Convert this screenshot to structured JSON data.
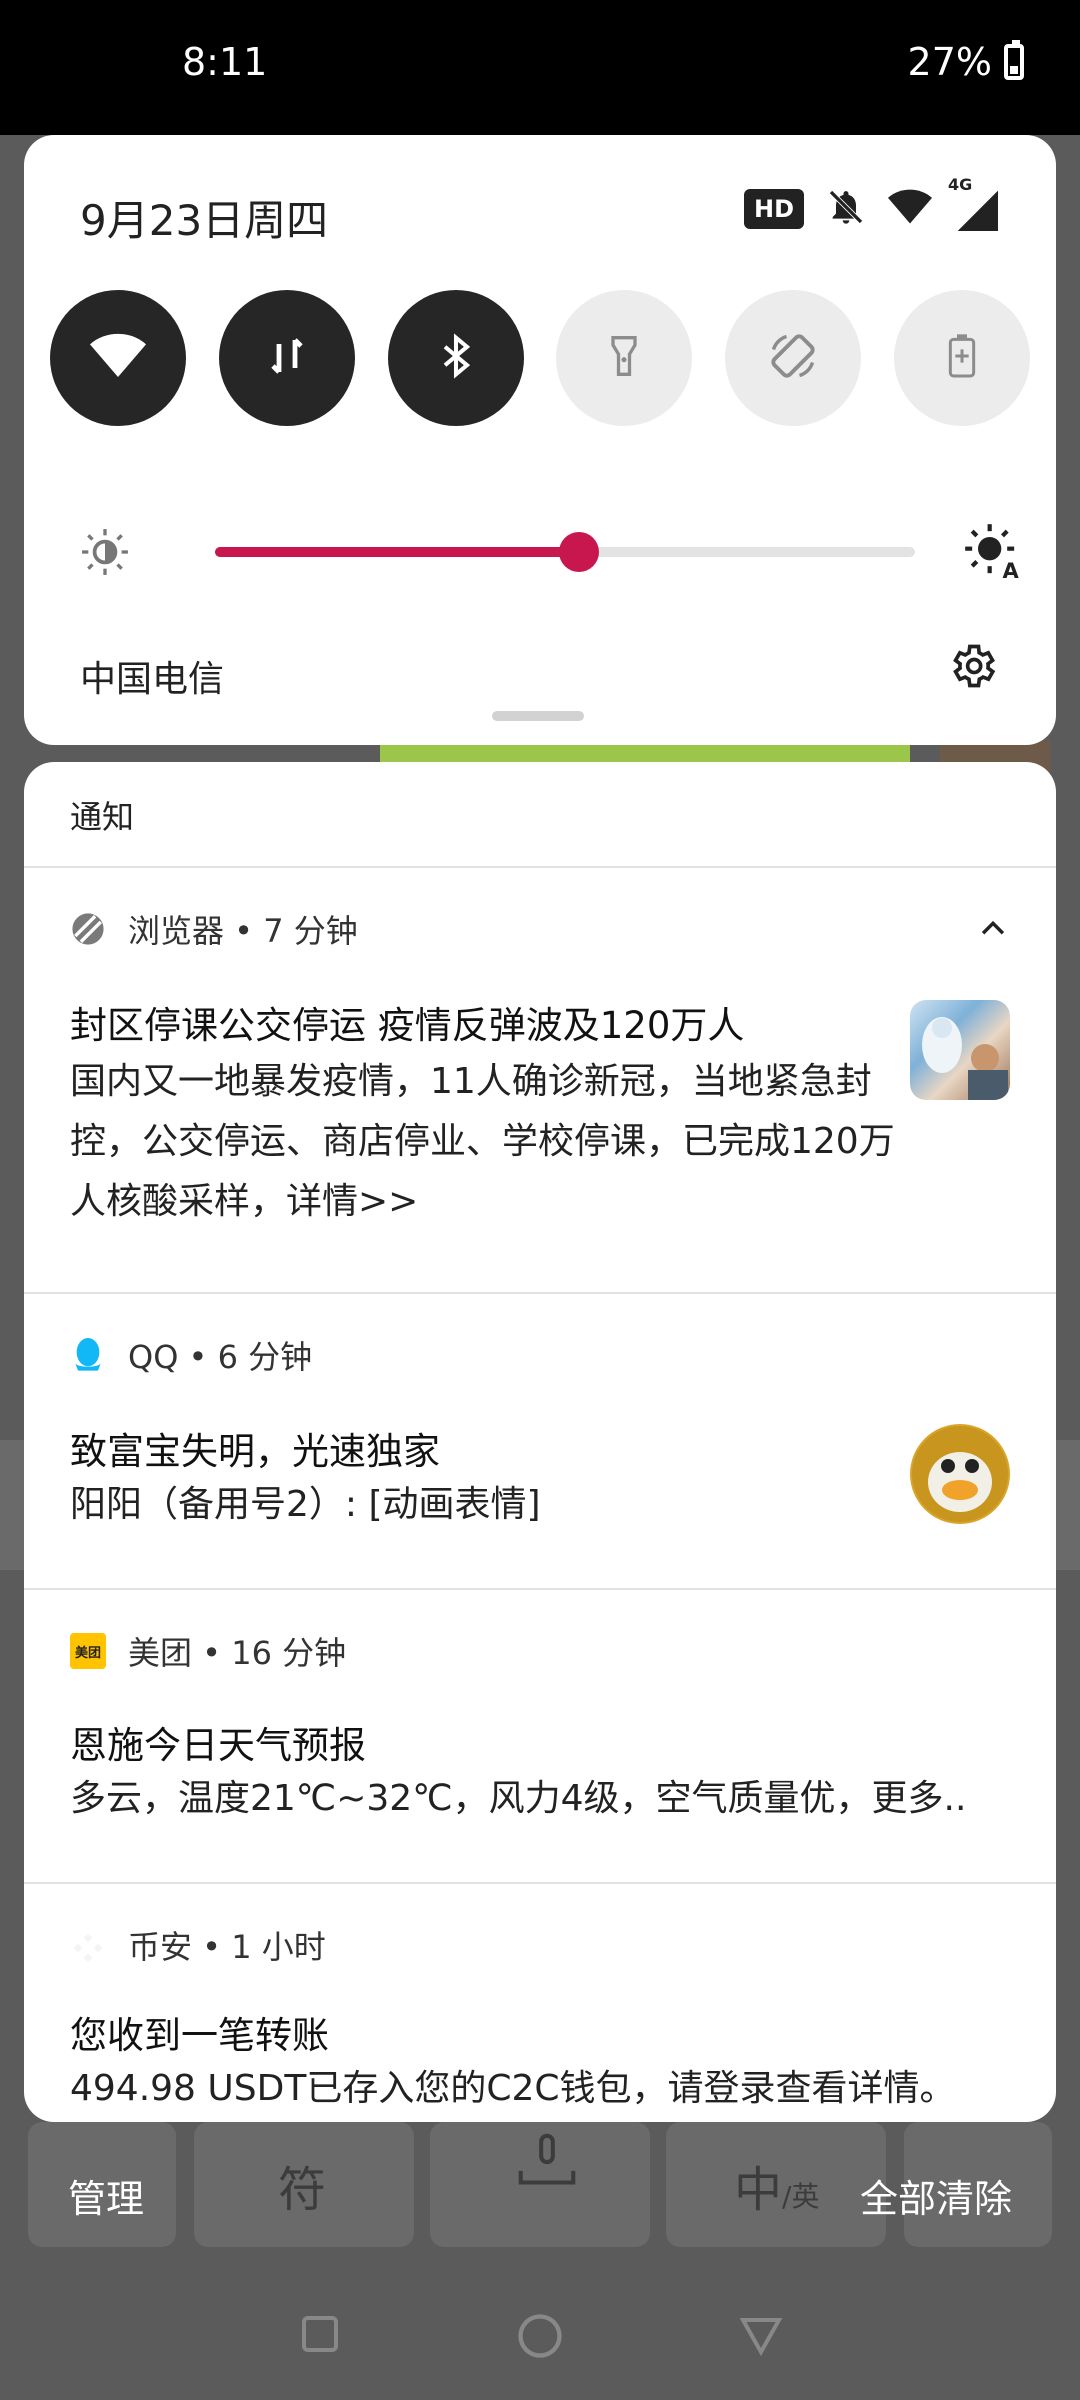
{
  "status_bar": {
    "time": "8:11",
    "battery": "27%"
  },
  "quick_settings": {
    "date": "9月23日周四",
    "status_icons": [
      "hd-badge",
      "bell-off-icon",
      "wifi-icon",
      "cellular-4g-icon"
    ],
    "hd_label": "HD",
    "network_label": "4G",
    "tiles": [
      {
        "name": "wifi-tile",
        "icon": "wifi-icon",
        "active": true
      },
      {
        "name": "mobile-data-tile",
        "icon": "data-transfer-icon",
        "active": true
      },
      {
        "name": "bluetooth-tile",
        "icon": "bluetooth-icon",
        "active": true
      },
      {
        "name": "flashlight-tile",
        "icon": "flashlight-icon",
        "active": false
      },
      {
        "name": "auto-rotate-tile",
        "icon": "rotate-icon",
        "active": false
      },
      {
        "name": "battery-saver-tile",
        "icon": "battery-plus-icon",
        "active": false
      }
    ],
    "brightness_level": 0.52,
    "accent_color": "#c8174e",
    "carrier": "中国电信"
  },
  "notifications": {
    "header": "通知",
    "items": [
      {
        "app": "浏览器",
        "meta": "浏览器 • 7 分钟",
        "title": "封区停课公交停运 疫情反弹波及120万人",
        "text": "国内又一地暴发疫情，11人确诊新冠，当地紧急封控，公交停运、商店停业、学校停课，已完成120万人核酸采样，详情>>"
      },
      {
        "app": "QQ",
        "meta": "QQ • 6 分钟",
        "title": "致富宝失明，光速独家",
        "text": "阳阳（备用号2）: [动画表情]"
      },
      {
        "app": "美团",
        "meta": "美团 • 16 分钟",
        "title": "恩施今日天气预报",
        "text": "多云，温度21℃~32℃，风力4级，空气质量优，更多.."
      },
      {
        "app": "币安",
        "meta": "币安 • 1 小时",
        "title": "您收到一笔转账",
        "text": "494.98 USDT已存入您的C2C钱包，请登录查看详情。"
      }
    ],
    "meituan_icon_label": "美团"
  },
  "actions": {
    "manage": "管理",
    "clear_all": "全部清除"
  },
  "keyboard_peek": {
    "key1": "符",
    "key3": "中",
    "key3_sub": "/英"
  }
}
